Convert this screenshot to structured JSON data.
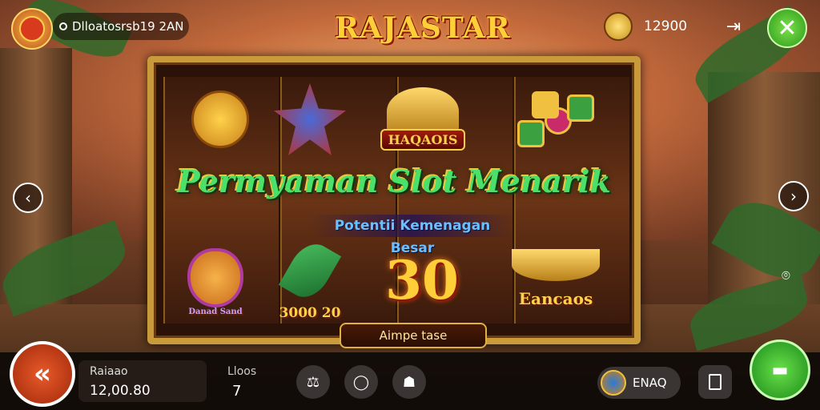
{
  "header": {
    "username": "Dlloatosrsb19 2AN",
    "logo": "RAJASTAR",
    "coins": "12900"
  },
  "slot": {
    "symbols": {
      "r1c3_label": "HAQAOIS",
      "r3c1_label": "Danad Sand",
      "r3c2_label": "3000 20",
      "r3c3_label": "30",
      "r3c4_label": "Eancaos"
    },
    "headline": "Permyaman Slot Menarik",
    "subheadline": "Potentii Kemenagan Besar",
    "bottom_plate": "Aimpe tase"
  },
  "footer": {
    "balance_label": "Raiaao",
    "balance_value": "12,00.80",
    "lines_label": "Lloos",
    "lines_value": "7",
    "bonus_label": "ENAQ"
  },
  "colors": {
    "accent_gold": "#ffcf3a",
    "spin_orange": "#e85a2a",
    "spin_green": "#2a9a1a",
    "headline_green": "#4ae06a",
    "subheadline_blue": "#6ac0ff"
  },
  "icons": [
    "rajastar-mask-avatar-icon",
    "status-dot-icon",
    "coin-icon",
    "exit-icon",
    "close-icon",
    "chevron-left-icon",
    "chevron-right-icon",
    "camera-icon",
    "rewind-icon",
    "settings-icon",
    "chat-icon",
    "profile-icon",
    "bonus-wheel-icon",
    "menu-icon",
    "spin-icon"
  ]
}
